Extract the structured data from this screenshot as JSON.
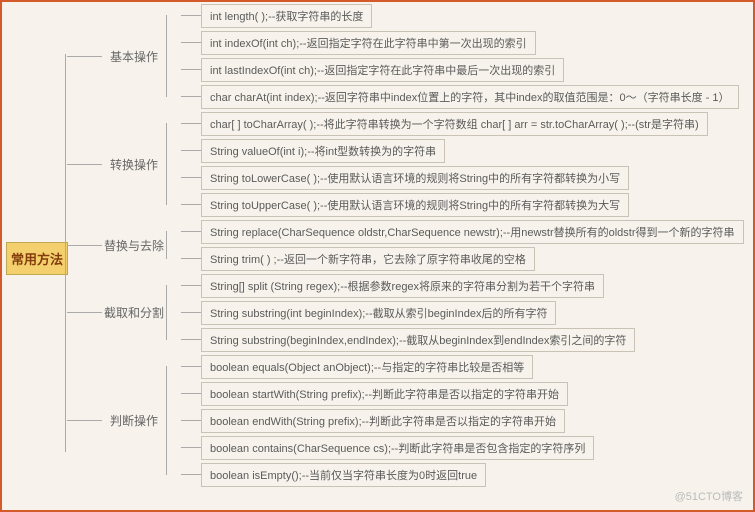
{
  "root": "常用方法",
  "watermark": "@51CTO博客",
  "categories": [
    {
      "label": "基本操作",
      "items": [
        "int length( );--获取字符串的长度",
        "int indexOf(int ch);--返回指定字符在此字符串中第一次出现的索引",
        "int lastIndexOf(int ch);--返回指定字符在此字符串中最后一次出现的索引",
        "char charAt(int index);--返回字符串中index位置上的字符，其中index的取值范围是：0～（字符串长度 - 1）"
      ]
    },
    {
      "label": "转换操作",
      "items": [
        "char[ ] toCharArray( );--将此字符串转换为一个字符数组        char[ ] arr = str.toCharArray( );--(str是字符串)",
        "String valueOf(int i);--将int型数转换为的字符串",
        "String toLowerCase( );--使用默认语言环境的规则将String中的所有字符都转换为小写",
        "String toUpperCase( );--使用默认语言环境的规则将String中的所有字符都转换为大写"
      ]
    },
    {
      "label": "替换与去除",
      "items": [
        "String replace(CharSequence oldstr,CharSequence newstr);--用newstr替换所有的oldstr得到一个新的字符串",
        "String trim( ) ;--返回一个新字符串，它去除了原字符串收尾的空格"
      ]
    },
    {
      "label": "截取和分割",
      "items": [
        "String[] split (String regex);--根据参数regex将原来的字符串分割为若干个字符串",
        "String substring(int beginIndex);--截取从索引beginIndex后的所有字符",
        "String substring(beginIndex,endIndex);--截取从beginIndex到endIndex索引之间的字符"
      ]
    },
    {
      "label": "判断操作",
      "items": [
        "boolean equals(Object anObject);--与指定的字符串比较是否相等",
        "boolean startWith(String prefix);--判断此字符串是否以指定的字符串开始",
        "boolean endWith(String prefix);--判断此字符串是否以指定的字符串开始",
        "boolean contains(CharSequence cs);--判断此字符串是否包含指定的字符序列",
        "boolean isEmpty();--当前仅当字符串长度为0时返回true"
      ]
    }
  ]
}
